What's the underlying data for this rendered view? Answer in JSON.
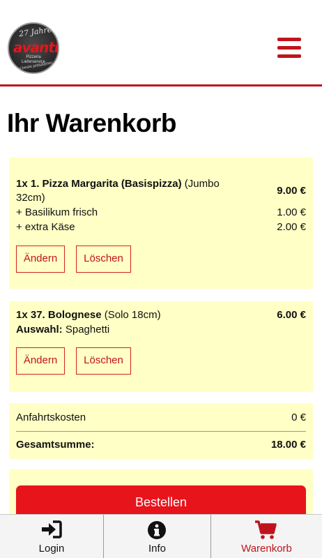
{
  "header": {
    "logo": {
      "years": "27 Jahre",
      "brand": "avanti",
      "sub1": "Pizzeria",
      "sub2": "Lieferservice",
      "url": "www.beste.potsdamer.pizza"
    }
  },
  "page": {
    "title": "Ihr Warenkorb"
  },
  "cart": {
    "items": [
      {
        "title_bold": "1x 1. Pizza Margarita (Basispizza)",
        "title_rest": "(Jumbo 32cm)",
        "price": "9.00 €",
        "extras": [
          {
            "label": "+ Basilikum frisch",
            "price": "1.00 €"
          },
          {
            "label": "+ extra Käse",
            "price": "2.00 €"
          }
        ],
        "edit_label": "Ändern",
        "delete_label": "Löschen"
      },
      {
        "title_bold": "1x 37. Bolognese",
        "title_rest": "(Solo 18cm)",
        "price": "6.00 €",
        "choice_label": "Auswahl:",
        "choice_value": "Spaghetti",
        "edit_label": "Ändern",
        "delete_label": "Löschen"
      }
    ],
    "delivery_label": "Anfahrtskosten",
    "delivery_value": "0 €",
    "total_label": "Gesamtsumme:",
    "total_value": "18.00 €",
    "order_label": "Bestellen"
  },
  "nav": {
    "items": [
      {
        "label": "Login",
        "icon": "sign-in-icon"
      },
      {
        "label": "Info",
        "icon": "info-icon"
      },
      {
        "label": "Warenkorb",
        "icon": "cart-icon",
        "active": true
      }
    ]
  },
  "colors": {
    "accent": "#c0141c",
    "button_red": "#e8141c",
    "card_bg": "#ffffc6"
  }
}
